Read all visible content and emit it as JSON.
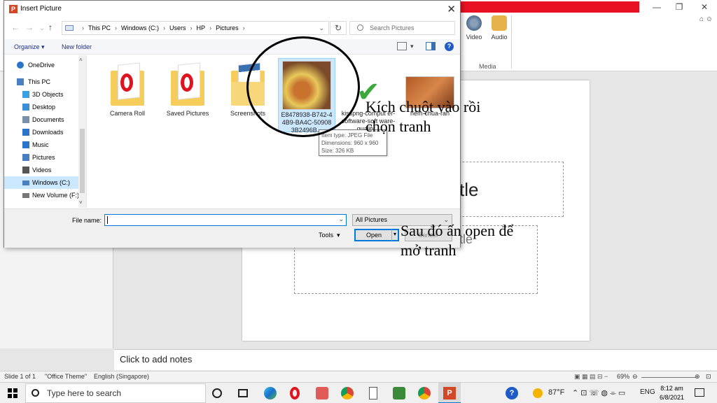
{
  "ppt": {
    "ribbon_video": "Video",
    "ribbon_audio": "Audio",
    "ribbon_group": "Media",
    "slide_title_partial": "tle",
    "slide_subtitle_partial": "tle",
    "notes_placeholder": "Click to add notes",
    "status_slide": "Slide 1 of 1",
    "status_theme": "\"Office Theme\"",
    "status_language": "English (Singapore)",
    "zoom": "69%"
  },
  "dialog": {
    "title": "Insert Picture",
    "breadcrumb": [
      "This PC",
      "Windows (C:)",
      "Users",
      "HP",
      "Pictures"
    ],
    "search_placeholder": "Search Pictures",
    "organize": "Organize",
    "new_folder": "New folder",
    "nav": [
      {
        "label": "OneDrive",
        "icon": "cloud-icon",
        "color": "#2a74c9"
      },
      {
        "label": "This PC",
        "icon": "computer-icon",
        "color": "#4a7fc1"
      },
      {
        "label": "3D Objects",
        "icon": "cube-icon",
        "color": "#3aa0e0"
      },
      {
        "label": "Desktop",
        "icon": "desktop-icon",
        "color": "#3a8fd8"
      },
      {
        "label": "Documents",
        "icon": "document-icon",
        "color": "#7a8fa8"
      },
      {
        "label": "Downloads",
        "icon": "download-icon",
        "color": "#2a74c9"
      },
      {
        "label": "Music",
        "icon": "music-icon",
        "color": "#2a74c9"
      },
      {
        "label": "Pictures",
        "icon": "picture-icon",
        "color": "#4a7fc1"
      },
      {
        "label": "Videos",
        "icon": "video-icon",
        "color": "#555555"
      },
      {
        "label": "Windows (C:)",
        "icon": "drive-icon",
        "color": "#4a7fc1"
      },
      {
        "label": "New Volume (F:)",
        "icon": "drive-icon",
        "color": "#777777"
      }
    ],
    "files": [
      {
        "name": "Camera Roll",
        "type": "folder"
      },
      {
        "name": "Saved Pictures",
        "type": "folder"
      },
      {
        "name": "Screenshots",
        "type": "folder"
      },
      {
        "name": "E8478938-B742-4 4B9-BA4C-50908 3B2496B...",
        "type": "image"
      },
      {
        "name": "kisspng-comput er-software-soft ware-quality...",
        "type": "image"
      },
      {
        "name": "nem-chua-ran",
        "type": "image"
      }
    ],
    "tooltip": {
      "type": "Item type: JPEG File",
      "dimensions": "Dimensions: 960 x 960",
      "size": "Size: 326 KB"
    },
    "file_name_label": "File name:",
    "file_name_value": "",
    "filter": "All Pictures",
    "tools": "Tools",
    "open": "Open",
    "cancel": "Cancel"
  },
  "annotations": {
    "click": [
      "Kích chuột vào rồi",
      "chọn tranh"
    ],
    "open": [
      "Sau đó ấn open để",
      "mở tranh"
    ]
  },
  "taskbar": {
    "search_placeholder": "Type here to search",
    "weather": "87°F",
    "language": "ENG",
    "time": "8:12 am",
    "date": "6/8/2021"
  }
}
